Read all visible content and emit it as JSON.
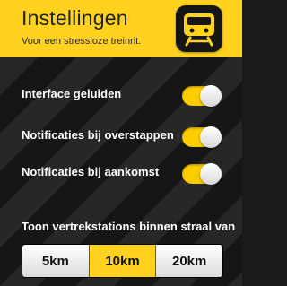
{
  "header": {
    "title": "Instellingen",
    "subtitle": "Voor een stressloze treinrit."
  },
  "colors": {
    "accent": "#ffd21f",
    "toggle_on": "#ffcc00",
    "dark": "#1a1a1a"
  },
  "settings": {
    "items": [
      {
        "label": "Interface geluiden",
        "enabled": true
      },
      {
        "label": "Notificaties bij overstappen",
        "enabled": true
      },
      {
        "label": "Notificaties bij aankomst",
        "enabled": true
      }
    ]
  },
  "radius": {
    "label": "Toon vertrekstations binnen straal van",
    "options": [
      "5km",
      "10km",
      "20km"
    ],
    "selected": "10km"
  },
  "icons": {
    "app": "train-icon"
  }
}
